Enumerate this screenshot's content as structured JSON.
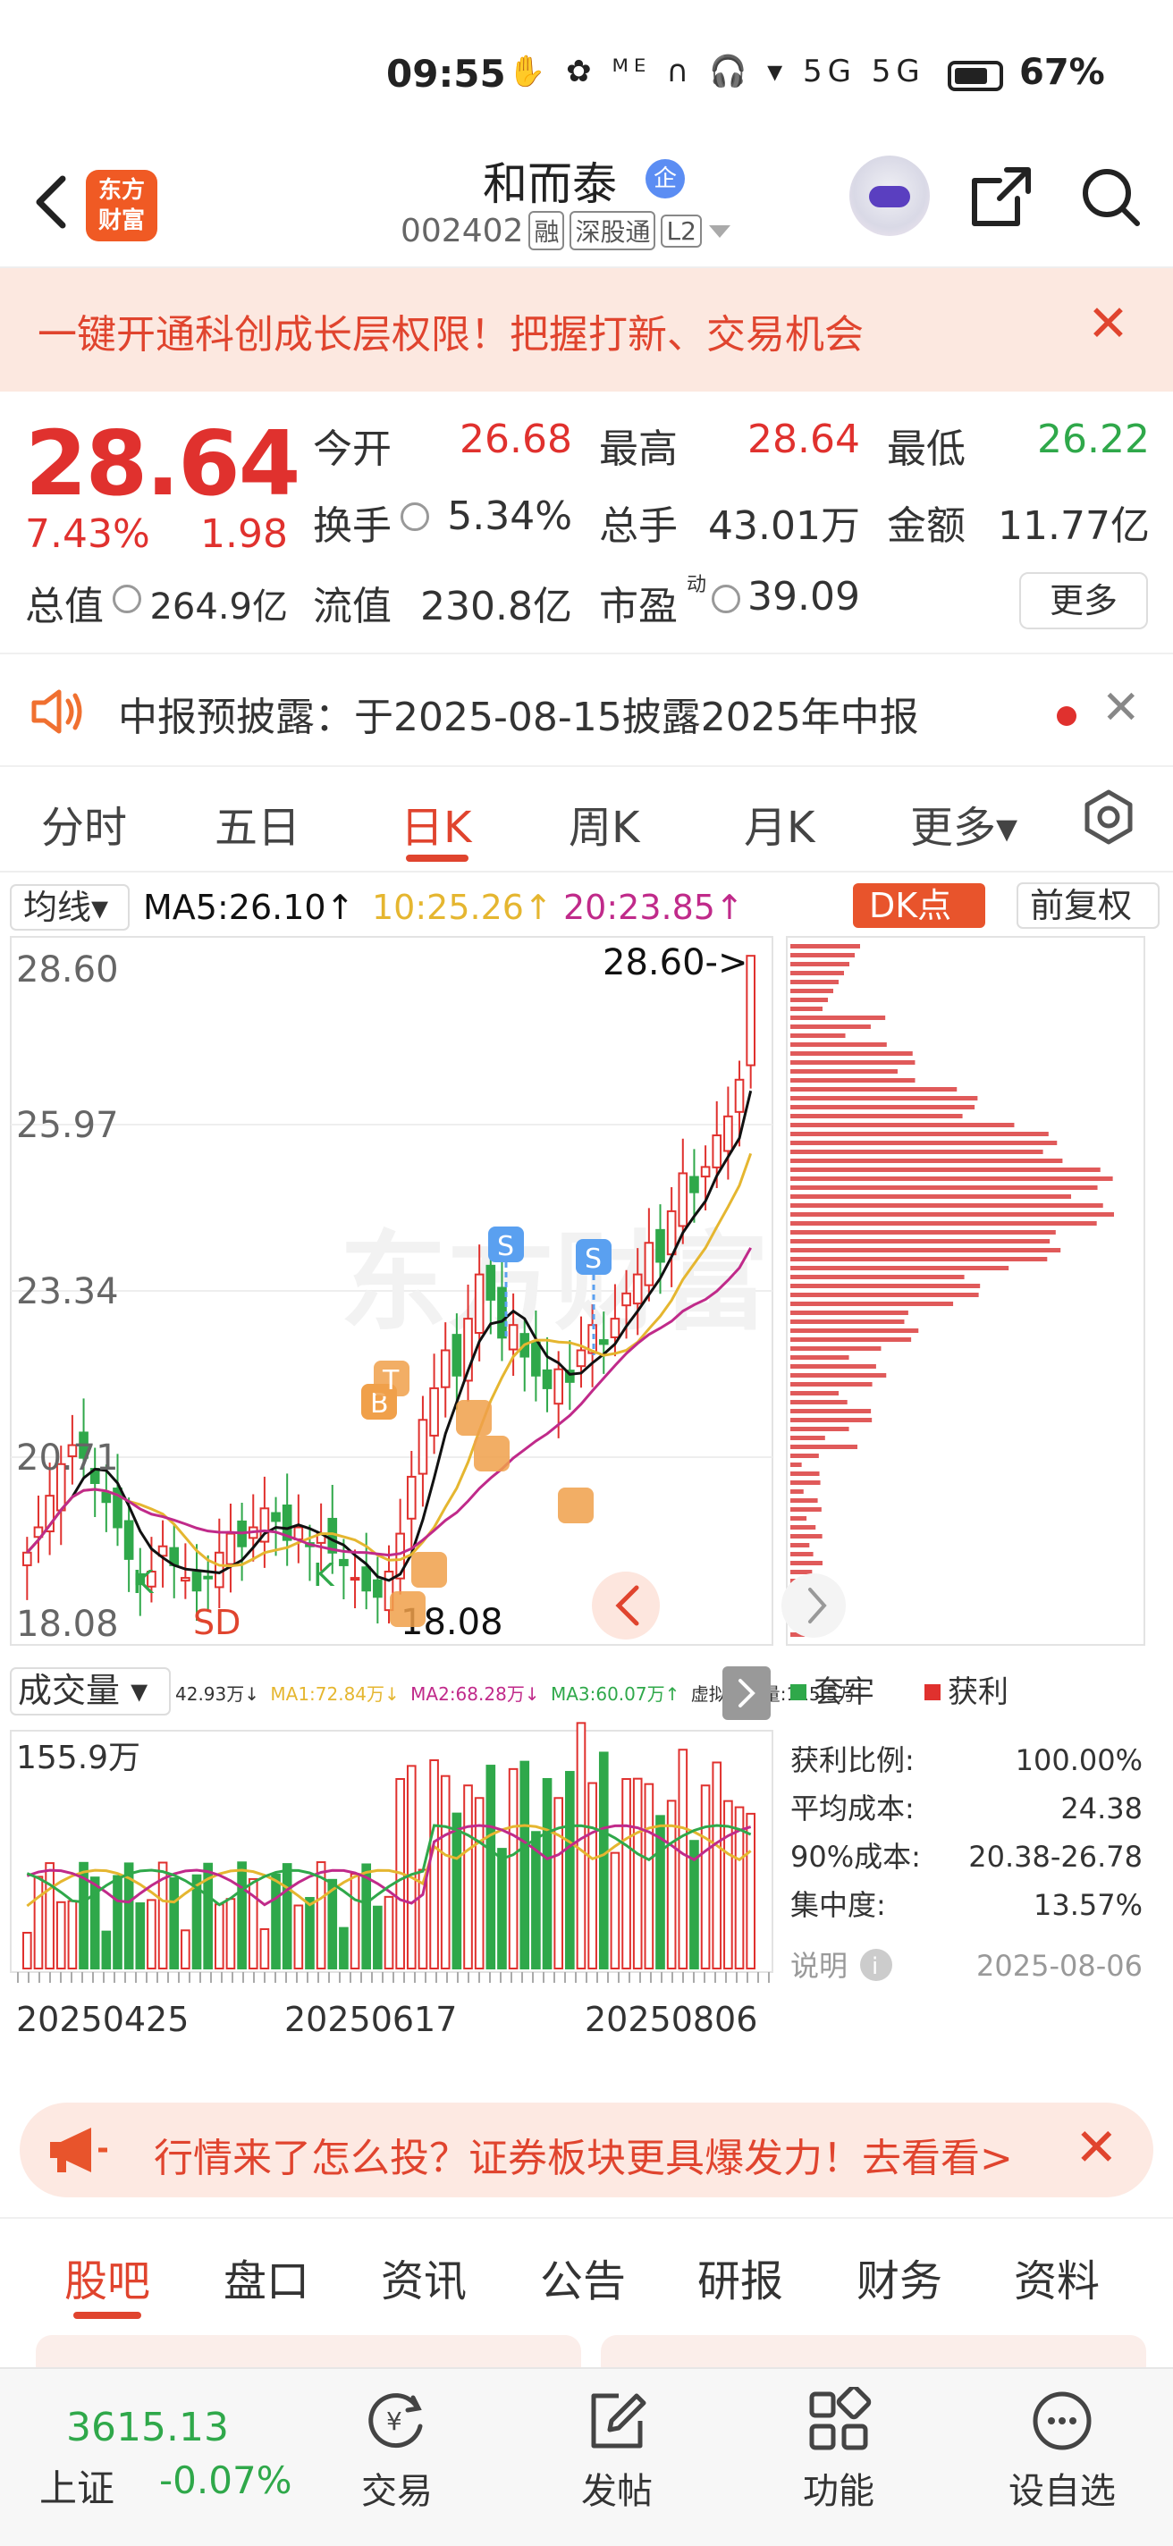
{
  "status_bar": {
    "time": "09:55",
    "icons": "✋ ✿ ᴹᴱ ∩ 🎧 ▾ 5G 5G",
    "battery": "67%"
  },
  "header": {
    "logo": "东方\n财富",
    "logo_line1": "东方",
    "logo_line2": "财富",
    "stock_name": "和而泰",
    "qi_badge": "企",
    "code": "002402",
    "tags": [
      "融",
      "深股通",
      "L2"
    ]
  },
  "promo": {
    "text": "一键开通科创成长层权限！把握打新、交易机会",
    "close": "✕"
  },
  "quote": {
    "price": "28.64",
    "change_pct": "7.43%",
    "change": "1.98",
    "open_label": "今开",
    "open": "26.68",
    "high_label": "最高",
    "high": "28.64",
    "low_label": "最低",
    "low": "26.22",
    "turnover_label": "换手",
    "turnover": "5.34%",
    "volume_label": "总手",
    "volume": "43.01万",
    "amount_label": "金额",
    "amount": "11.77亿",
    "mktcap_label": "总值",
    "mktcap": "264.9亿",
    "float_label": "流值",
    "float": "230.8亿",
    "pe_label": "市盈",
    "pe_sup": "动",
    "pe": "39.09",
    "more": "更多"
  },
  "notice": {
    "text": "中报预披露：于2025-08-15披露2025年中报",
    "close": "✕"
  },
  "period_tabs": [
    "分时",
    "五日",
    "日K",
    "周K",
    "月K",
    "更多▾"
  ],
  "active_period": "日K",
  "chart": {
    "ma_selector": "均线▾",
    "ma5": "MA5:26.10↑",
    "ma10": "10:25.26↑",
    "ma20": "20:23.85↑",
    "dk_button": "DK点",
    "adjust_button": "前复权",
    "y_ticks": [
      "28.60",
      "25.97",
      "23.34",
      "20.71",
      "18.08"
    ],
    "max_label": "28.60->",
    "min_label": "18.08",
    "vol_selector": "成交量 ▾",
    "vol_legend": "42.93万↓ MA1:72.84万↓ MA2:68.28万↓ MA3:60.07万↑ 虚拟成交量:115.5万",
    "vol_legend_parts": {
      "v": "42.93万↓",
      "ma1": "MA1:72.84万↓",
      "ma2": "MA2:68.28万↓",
      "ma3": "MA3:60.07万↑",
      "virt": "虚拟成交量:115.5万"
    },
    "vol_max": "155.9万",
    "x_labels": [
      "20250425",
      "20250617",
      "20250806"
    ],
    "profile": {
      "legend_trapped": "套牢",
      "legend_profit": "获利",
      "rows": [
        {
          "label": "获利比例:",
          "value": "100.00%"
        },
        {
          "label": "平均成本:",
          "value": "24.38"
        },
        {
          "label": "90%成本:",
          "value": "20.38-26.78"
        },
        {
          "label": "集中度:",
          "value": "13.57%"
        }
      ],
      "note_label": "说明",
      "date": "2025-08-06"
    },
    "colors": {
      "up": "#e0312e",
      "down": "#2fa84a",
      "ma5": "#111111",
      "ma10": "#e5b630",
      "ma20": "#c02a8a"
    }
  },
  "ad": {
    "text": "行情来了怎么投？证券板块更具爆发力！去看看>",
    "close": "✕"
  },
  "sub_tabs": [
    "股吧",
    "盘口",
    "资讯",
    "公告",
    "研报",
    "财务",
    "资料"
  ],
  "active_sub_tab": "股吧",
  "bottom_nav": {
    "index_value": "3615.13",
    "index_name": "上证",
    "index_change": "-0.07%",
    "items": [
      "交易",
      "发帖",
      "功能",
      "设自选"
    ]
  }
}
